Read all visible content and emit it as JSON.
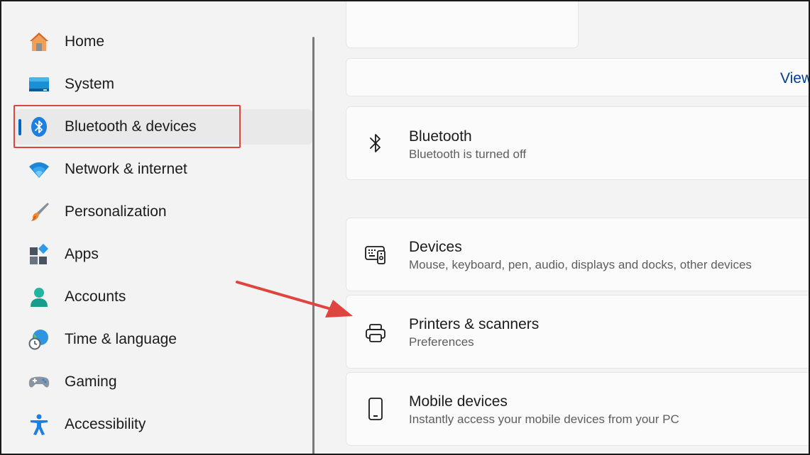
{
  "sidebar": {
    "items": [
      {
        "label": "Home",
        "icon": "home-icon"
      },
      {
        "label": "System",
        "icon": "system-icon"
      },
      {
        "label": "Bluetooth & devices",
        "icon": "bluetooth-devices-icon",
        "selected": true
      },
      {
        "label": "Network & internet",
        "icon": "wifi-icon"
      },
      {
        "label": "Personalization",
        "icon": "brush-icon"
      },
      {
        "label": "Apps",
        "icon": "apps-icon"
      },
      {
        "label": "Accounts",
        "icon": "account-icon"
      },
      {
        "label": "Time & language",
        "icon": "globe-clock-icon"
      },
      {
        "label": "Gaming",
        "icon": "gamepad-icon"
      },
      {
        "label": "Accessibility",
        "icon": "accessibility-icon"
      }
    ]
  },
  "main": {
    "view_link": "View",
    "bluetooth": {
      "title": "Bluetooth",
      "subtitle": "Bluetooth is turned off"
    },
    "devices": {
      "title": "Devices",
      "subtitle": "Mouse, keyboard, pen, audio, displays and docks, other devices"
    },
    "printers": {
      "title": "Printers & scanners",
      "subtitle": "Preferences"
    },
    "mobile": {
      "title": "Mobile devices",
      "subtitle": "Instantly access your mobile devices from your PC"
    }
  },
  "colors": {
    "accent": "#0067c0",
    "annotation": "#e0443e",
    "link": "#003e92"
  }
}
